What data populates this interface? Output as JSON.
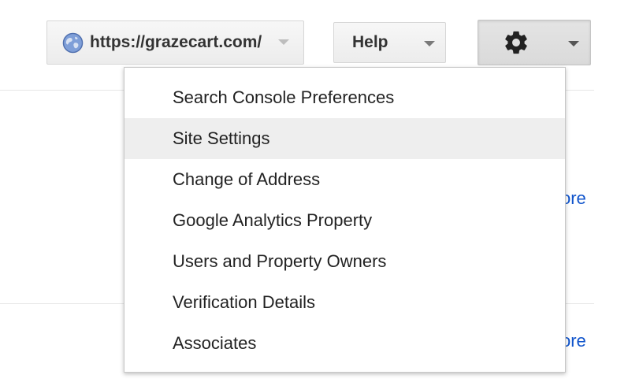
{
  "toolbar": {
    "site_selector": {
      "label": "https://grazecart.com/",
      "icon": "globe-icon"
    },
    "help_button": {
      "label": "Help"
    },
    "settings_button": {
      "icon": "gear-icon"
    }
  },
  "background": {
    "more_link_1": "ore",
    "more_link_2": "ore"
  },
  "settings_menu": {
    "items": [
      {
        "label": "Search Console Preferences"
      },
      {
        "label": "Site Settings",
        "highlighted": true
      },
      {
        "label": "Change of Address"
      },
      {
        "label": "Google Analytics Property"
      },
      {
        "label": "Users and Property Owners"
      },
      {
        "label": "Verification Details"
      },
      {
        "label": "Associates"
      }
    ]
  },
  "colors": {
    "link": "#1155cc",
    "highlight": "#eeeeee",
    "button_text": "#333333"
  }
}
